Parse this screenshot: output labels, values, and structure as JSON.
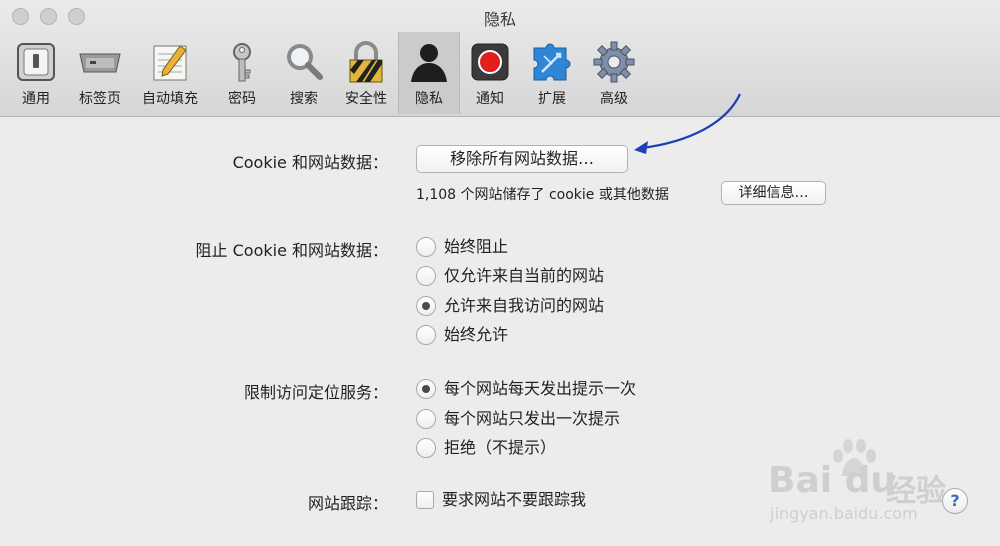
{
  "window": {
    "title": "隐私"
  },
  "toolbar": {
    "items": [
      {
        "label": "通用",
        "icon": "switch-icon"
      },
      {
        "label": "标签页",
        "icon": "tabs-icon"
      },
      {
        "label": "自动填充",
        "icon": "pencil-icon"
      },
      {
        "label": "密码",
        "icon": "key-icon"
      },
      {
        "label": "搜索",
        "icon": "magnifier-icon"
      },
      {
        "label": "安全性",
        "icon": "lock-icon"
      },
      {
        "label": "隐私",
        "icon": "person-icon",
        "selected": true
      },
      {
        "label": "通知",
        "icon": "record-icon"
      },
      {
        "label": "扩展",
        "icon": "puzzle-icon"
      },
      {
        "label": "高级",
        "icon": "gear-icon"
      }
    ]
  },
  "cookies": {
    "label": "Cookie 和网站数据：",
    "remove_button": "移除所有网站数据…",
    "info_text": "1,108 个网站储存了 cookie 或其他数据",
    "details_button": "详细信息…"
  },
  "block": {
    "label": "阻止 Cookie 和网站数据：",
    "options": [
      {
        "label": "始终阻止",
        "checked": false
      },
      {
        "label": "仅允许来自当前的网站",
        "checked": false
      },
      {
        "label": "允许来自我访问的网站",
        "checked": true
      },
      {
        "label": "始终允许",
        "checked": false
      }
    ]
  },
  "location": {
    "label": "限制访问定位服务：",
    "options": [
      {
        "label": "每个网站每天发出提示一次",
        "checked": true
      },
      {
        "label": "每个网站只发出一次提示",
        "checked": false
      },
      {
        "label": "拒绝（不提示）",
        "checked": false
      }
    ]
  },
  "tracking": {
    "label": "网站跟踪：",
    "checkbox_label": "要求网站不要跟踪我",
    "checked": false
  },
  "help": {
    "glyph": "?"
  },
  "watermark": {
    "brand": "Bai du",
    "cn": "经验",
    "url": "jingyan.baidu.com"
  },
  "colors": {
    "arrow": "#1f3fb5",
    "help": "#3b6cc2"
  }
}
